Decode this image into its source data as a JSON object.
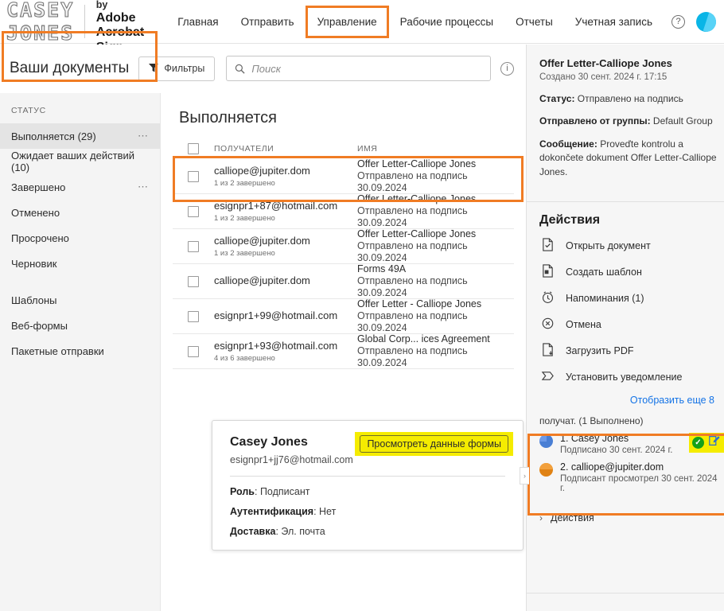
{
  "topbar": {
    "logo_text": "CASEY JONES",
    "powered_by": "Powered by",
    "brand_line1": "Adobe",
    "brand_line2": "Acrobat Sign",
    "nav": [
      {
        "label": "Главная",
        "active": false
      },
      {
        "label": "Отправить",
        "active": false
      },
      {
        "label": "Управление",
        "active": true
      },
      {
        "label": "Рабочие процессы",
        "active": false
      },
      {
        "label": "Отчеты",
        "active": false
      },
      {
        "label": "Учетная запись",
        "active": false
      }
    ],
    "help_glyph": "?",
    "avatar_name": "user-avatar"
  },
  "subheader": {
    "page_title": "Ваши документы",
    "filters_label": "Фильтры",
    "search_placeholder": "Поиск",
    "search_value": "",
    "info_glyph": "i"
  },
  "sidebar": {
    "section_label": "СТАТУС",
    "items": [
      {
        "label": "Выполняется",
        "count": "(29)",
        "dots": "⋯",
        "selected": true
      },
      {
        "label": "Ожидает ваших действий",
        "count": "(10)",
        "dots": "",
        "selected": false
      },
      {
        "label": "Завершено",
        "count": "",
        "dots": "⋯",
        "selected": false
      },
      {
        "label": "Отменено",
        "count": "",
        "dots": "",
        "selected": false
      },
      {
        "label": "Просрочено",
        "count": "",
        "dots": "",
        "selected": false
      },
      {
        "label": "Черновик",
        "count": "",
        "dots": "",
        "selected": false
      }
    ],
    "items2": [
      {
        "label": "Шаблоны"
      },
      {
        "label": "Веб-формы"
      },
      {
        "label": "Пакетные отправки"
      }
    ]
  },
  "main": {
    "heading": "Выполняется",
    "columns": {
      "recipients": "ПОЛУЧАТЕЛИ",
      "name": "ИМЯ"
    },
    "rows": [
      {
        "recipient": "calliope@jupiter.dom",
        "progress": "1 из 2 завершено",
        "title": "Offer Letter-Calliope Jones",
        "status": "Отправлено на подпись",
        "date": "30.09.2024"
      },
      {
        "recipient": "esignpr1+87@hotmail.com",
        "progress": "1 из 2 завершено",
        "title": "Offer Letter-Calliope Jones",
        "status": "Отправлено на подпись",
        "date": "30.09.2024"
      },
      {
        "recipient": "calliope@jupiter.dom",
        "progress": "1 из 2 завершено",
        "title": "Offer Letter-Calliope Jones",
        "status": "Отправлено на подпись",
        "date": "30.09.2024"
      },
      {
        "recipient": "calliope@jupiter.dom",
        "progress": "",
        "title": "Forms 49A",
        "status": "Отправлено на подпись",
        "date": "30.09.2024"
      },
      {
        "recipient": "esignpr1+99@hotmail.com",
        "progress": "",
        "title": "Offer Letter - Calliope Jones",
        "status": "Отправлено на подпись",
        "date": "30.09.2024"
      },
      {
        "recipient": "esignpr1+93@hotmail.com",
        "progress": "4 из 6 завершено",
        "title": "Global Corp... ices Agreement",
        "status": "Отправлено на подпись",
        "date": "30.09.2024"
      }
    ]
  },
  "popup": {
    "name": "Casey Jones",
    "email": "esignpr1+jj76@hotmail.com",
    "form_button": "Просмотреть данные формы",
    "role_label": "Роль",
    "role_value": "Подписант",
    "auth_label": "Аутентификация",
    "auth_value": "Нет",
    "delivery_label": "Доставка",
    "delivery_value": "Эл. почта"
  },
  "right_panel": {
    "doc_title": "Offer Letter-Calliope Jones",
    "created": "Создано 30 сент. 2024 г. 17:15",
    "status_label": "Статус:",
    "status_value": "Отправлено на подпись",
    "group_label": "Отправлено от группы:",
    "group_value": "Default Group",
    "message_label": "Сообщение:",
    "message_value": "Proveďte kontrolu a dokončete dokument Offer Letter-Calliope Jones.",
    "actions_heading": "Действия",
    "actions": [
      {
        "label": "Открыть документ",
        "icon": "open-document-icon"
      },
      {
        "label": "Создать шаблон",
        "icon": "create-template-icon"
      },
      {
        "label": "Напоминания (1)",
        "icon": "reminder-clock-icon"
      },
      {
        "label": "Отмена",
        "icon": "cancel-circle-icon"
      },
      {
        "label": "Загрузить PDF",
        "icon": "download-pdf-icon"
      },
      {
        "label": "Установить уведомление",
        "icon": "notification-icon"
      }
    ],
    "show_more": "Отобразить еще 8",
    "recipients_heading": "получат. (1 Выполнено)",
    "recipients": [
      {
        "label": "1. Casey Jones",
        "status": "Подписано 30 сент. 2024 г.",
        "avatar": "blue",
        "has_icons": true,
        "check_glyph": "✓"
      },
      {
        "label": "2. calliope@jupiter.dom",
        "status": "Подписант просмотрел 30 сент. 2024 г.",
        "avatar": "orange",
        "has_icons": false,
        "check_glyph": ""
      }
    ],
    "bottom_section": "Действия",
    "bottom_chevron": "›"
  },
  "colors": {
    "accent_orange": "#f07c24",
    "highlight_yellow": "#f5ec00",
    "link_blue": "#1473e6",
    "green_check": "#15a01a"
  }
}
